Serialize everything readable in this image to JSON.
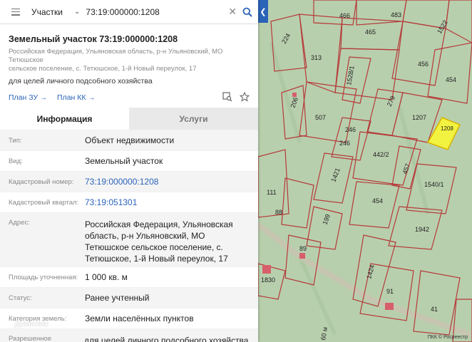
{
  "search": {
    "category": "Участки",
    "query": "73:19:000000:1208"
  },
  "header": {
    "title": "Земельный участок 73:19:000000:1208",
    "address_line1": "Российская Федерация, Ульяновская область, р-н Ульяновский, МО Тетюшское",
    "address_line2": "сельское поселение, с. Тетюшское, 1-й Новый переулок, 17",
    "purpose": "для целей личного подсобного хозяйства",
    "plan_zu": "План ЗУ",
    "plan_kk": "План КК"
  },
  "tabs": [
    {
      "label": "Информация",
      "active": true
    },
    {
      "label": "Услуги",
      "active": false
    }
  ],
  "details": [
    {
      "key": "Тип:",
      "value": "Объект недвижимости",
      "link": false
    },
    {
      "key": "Вид:",
      "value": "Земельный участок",
      "link": false
    },
    {
      "key": "Кадастровый номер:",
      "value": "73:19:000000:1208",
      "link": true
    },
    {
      "key": "Кадастровый квартал:",
      "value": "73:19:051301",
      "link": true
    },
    {
      "key": "Адрес:",
      "value": "Российская Федерация, Ульяновская область, р-н Ульяновский, МО Тетюшское сельское поселение, с. Тетюшское, 1-й Новый переулок, 17",
      "link": false
    },
    {
      "key": "Площадь уточненная:",
      "value": "1 000 кв. м",
      "link": false
    },
    {
      "key": "Статус:",
      "value": "Ранее учтенный",
      "link": false
    },
    {
      "key": "Категория земель:",
      "value": "Земли населённых пунктов",
      "link": false
    },
    {
      "key": "Разрешенное использование:",
      "value": "для целей личного подсобного хозяйства",
      "link": false
    }
  ],
  "map": {
    "labels": [
      "466",
      "483",
      "1522",
      "465",
      "224",
      "313",
      "456",
      "1528/1",
      "454",
      "206",
      "279",
      "507",
      "1207",
      "1208",
      "246",
      "246",
      "442/2",
      "457",
      "1540/1",
      "1421",
      "111",
      "454",
      "88",
      "199",
      "1942",
      "89",
      "1424",
      "1830",
      "91",
      "41"
    ],
    "highlight": "1208"
  },
  "watermark": "Домклик",
  "copyright": "ПКК © Росреестр",
  "colors": {
    "accent": "#2a63b8",
    "parcel_border": "#b33",
    "highlight_fill": "#f2f240"
  }
}
